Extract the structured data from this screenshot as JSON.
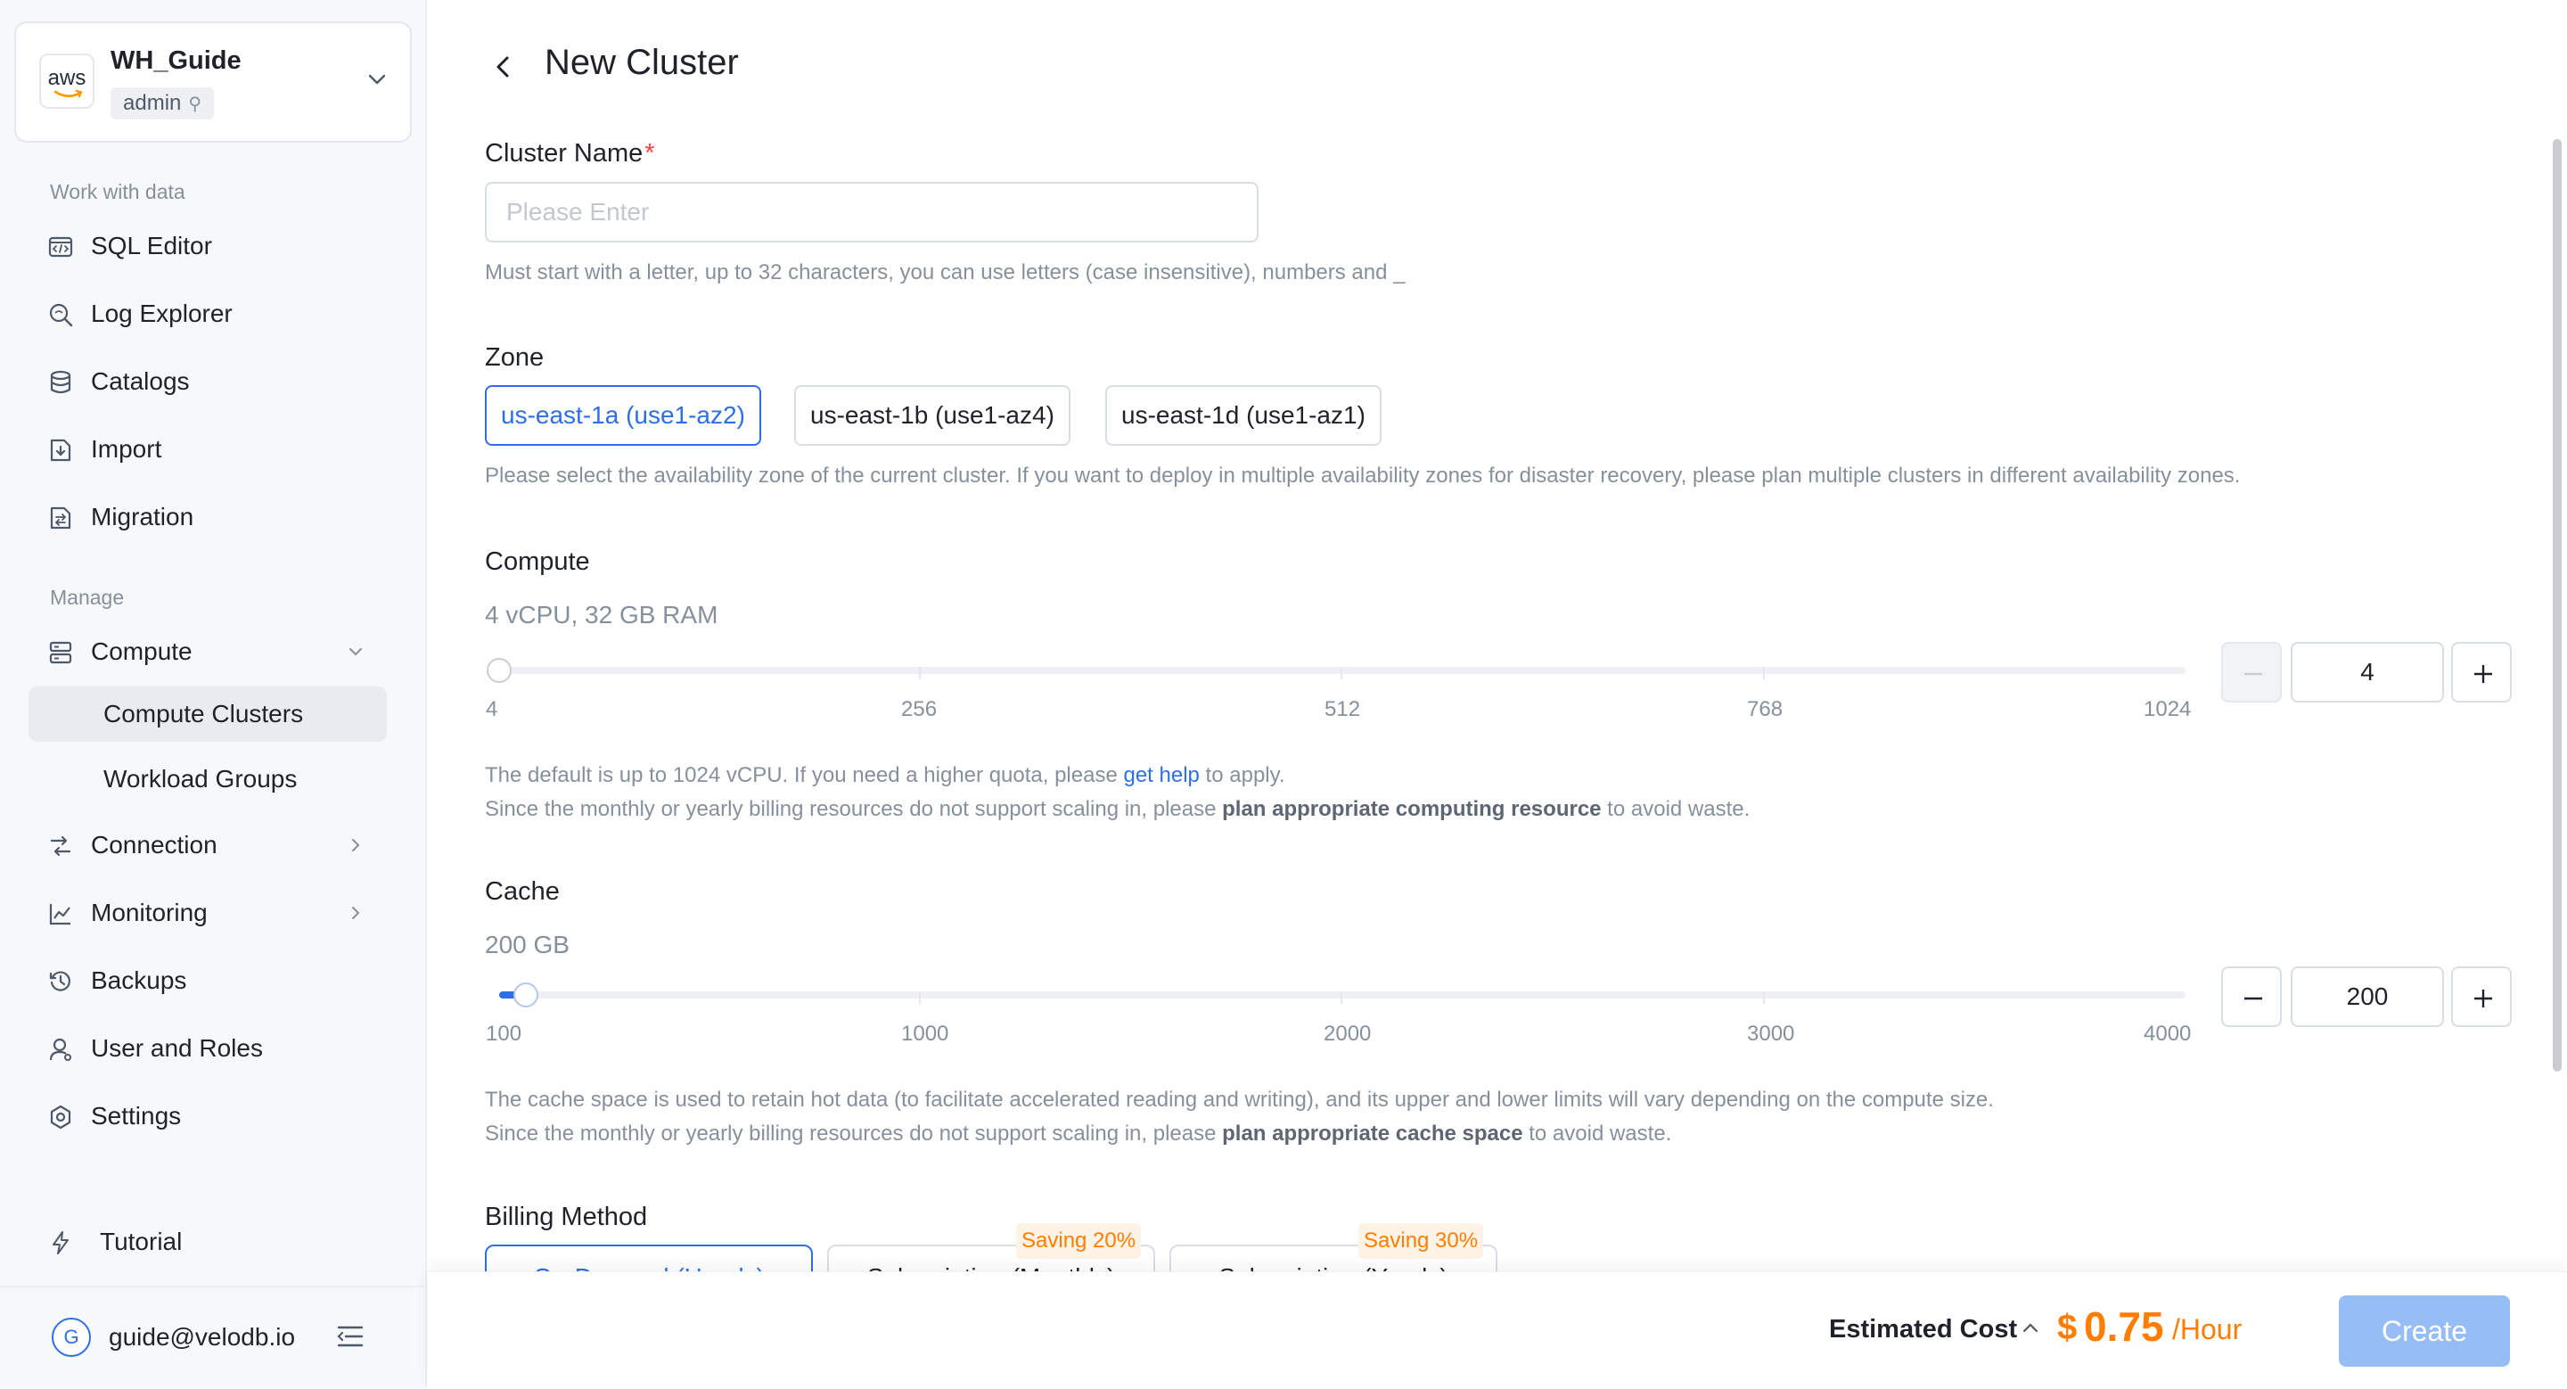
{
  "account": {
    "logo_text": "aws",
    "name": "WH_Guide",
    "role": "admin"
  },
  "sidebar": {
    "section_work": "Work with data",
    "work_items": [
      {
        "label": "SQL Editor",
        "icon": "sql-editor-icon"
      },
      {
        "label": "Log Explorer",
        "icon": "search-icon"
      },
      {
        "label": "Catalogs",
        "icon": "database-icon"
      },
      {
        "label": "Import",
        "icon": "import-icon"
      },
      {
        "label": "Migration",
        "icon": "migration-icon"
      }
    ],
    "section_manage": "Manage",
    "compute": {
      "label": "Compute",
      "icon": "server-icon"
    },
    "compute_sub": [
      {
        "label": "Compute Clusters",
        "active": true
      },
      {
        "label": "Workload Groups",
        "active": false
      }
    ],
    "manage_items": [
      {
        "label": "Connection",
        "icon": "connection-icon"
      },
      {
        "label": "Monitoring",
        "icon": "chart-icon"
      },
      {
        "label": "Backups",
        "icon": "history-icon"
      },
      {
        "label": "User and Roles",
        "icon": "user-icon"
      },
      {
        "label": "Settings",
        "icon": "settings-icon"
      }
    ],
    "tutorial": "Tutorial",
    "user": {
      "initial": "G",
      "email": "guide@velodb.io"
    }
  },
  "page": {
    "title": "New Cluster"
  },
  "cluster_name": {
    "label": "Cluster Name",
    "required_mark": "*",
    "placeholder": "Please Enter",
    "value": "",
    "hint": "Must start with a letter, up to 32 characters, you can use letters (case insensitive), numbers and _"
  },
  "zone": {
    "label": "Zone",
    "options": [
      "us-east-1a (use1-az2)",
      "us-east-1b (use1-az4)",
      "us-east-1d (use1-az1)"
    ],
    "selected_index": 0,
    "hint": "Please select the availability zone of the current cluster. If you want to deploy in multiple availability zones for disaster recovery, please plan multiple clusters in different availability zones."
  },
  "compute": {
    "label": "Compute",
    "summary": "4 vCPU, 32 GB RAM",
    "ticks": [
      "4",
      "256",
      "512",
      "768",
      "1024"
    ],
    "min": 4,
    "max": 1024,
    "value": "4",
    "fill_fraction": 0,
    "hint1_pre": "The default is up to 1024 vCPU. If you need a higher quota, please ",
    "hint1_link": "get help",
    "hint1_post": " to apply.",
    "hint2_pre": "Since the monthly or yearly billing resources do not support scaling in, please ",
    "hint2_bold": "plan appropriate computing resource",
    "hint2_post": " to avoid waste."
  },
  "cache": {
    "label": "Cache",
    "summary": "200 GB",
    "ticks": [
      "100",
      "1000",
      "2000",
      "3000",
      "4000"
    ],
    "min": 100,
    "max": 4000,
    "value": "200",
    "fill_fraction": 0.016,
    "hint1": "The cache space is used to retain hot data (to facilitate accelerated reading and writing), and its upper and lower limits will vary depending on the compute size.",
    "hint2_pre": "Since the monthly or yearly billing resources do not support scaling in, please ",
    "hint2_bold": "plan appropriate cache space",
    "hint2_post": " to avoid waste."
  },
  "billing": {
    "label": "Billing Method",
    "options": [
      {
        "label": "On-Demand (Hourly)",
        "badge": ""
      },
      {
        "label": "Subscription (Monthly)",
        "badge": "Saving 20%"
      },
      {
        "label": "Subscription (Yearly)",
        "badge": "Saving 30%"
      }
    ],
    "selected_index": 0
  },
  "footer": {
    "estimated_label": "Estimated Cost",
    "currency": "$",
    "price": "0.75",
    "unit": "/Hour",
    "create_label": "Create"
  },
  "colors": {
    "accent": "#2f6fe4",
    "price": "#ff7d00",
    "create_disabled": "#97bdf5"
  }
}
